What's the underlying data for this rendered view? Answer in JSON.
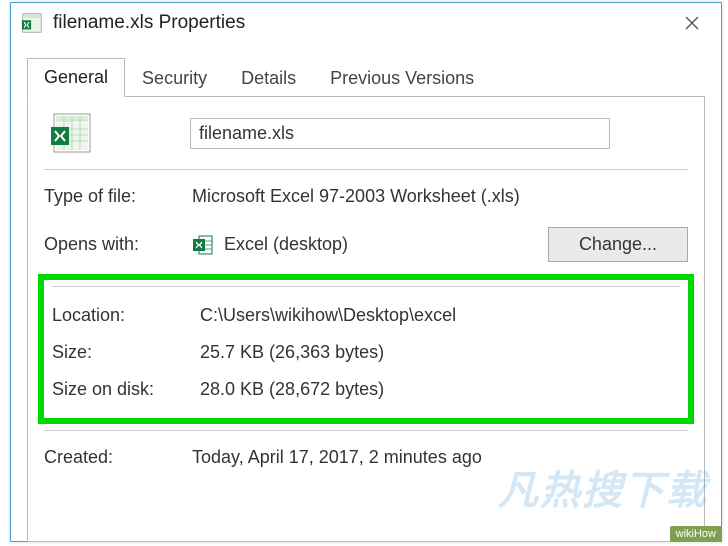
{
  "window": {
    "title": "filename.xls Properties"
  },
  "tabs": {
    "general": "General",
    "security": "Security",
    "details": "Details",
    "previous": "Previous Versions"
  },
  "header": {
    "filename": "filename.xls"
  },
  "fields": {
    "type_label": "Type of file:",
    "type_value": "Microsoft Excel 97-2003 Worksheet (.xls)",
    "opens_label": "Opens with:",
    "opens_value": "Excel (desktop)",
    "change_button": "Change...",
    "location_label": "Location:",
    "location_value": "C:\\Users\\wikihow\\Desktop\\excel",
    "size_label": "Size:",
    "size_value": "25.7 KB (26,363 bytes)",
    "sizeondisk_label": "Size on disk:",
    "sizeondisk_value": "28.0 KB (28,672 bytes)",
    "created_label": "Created:",
    "created_value": "Today, April 17, 2017, 2 minutes ago"
  },
  "watermark": "wikiHow"
}
